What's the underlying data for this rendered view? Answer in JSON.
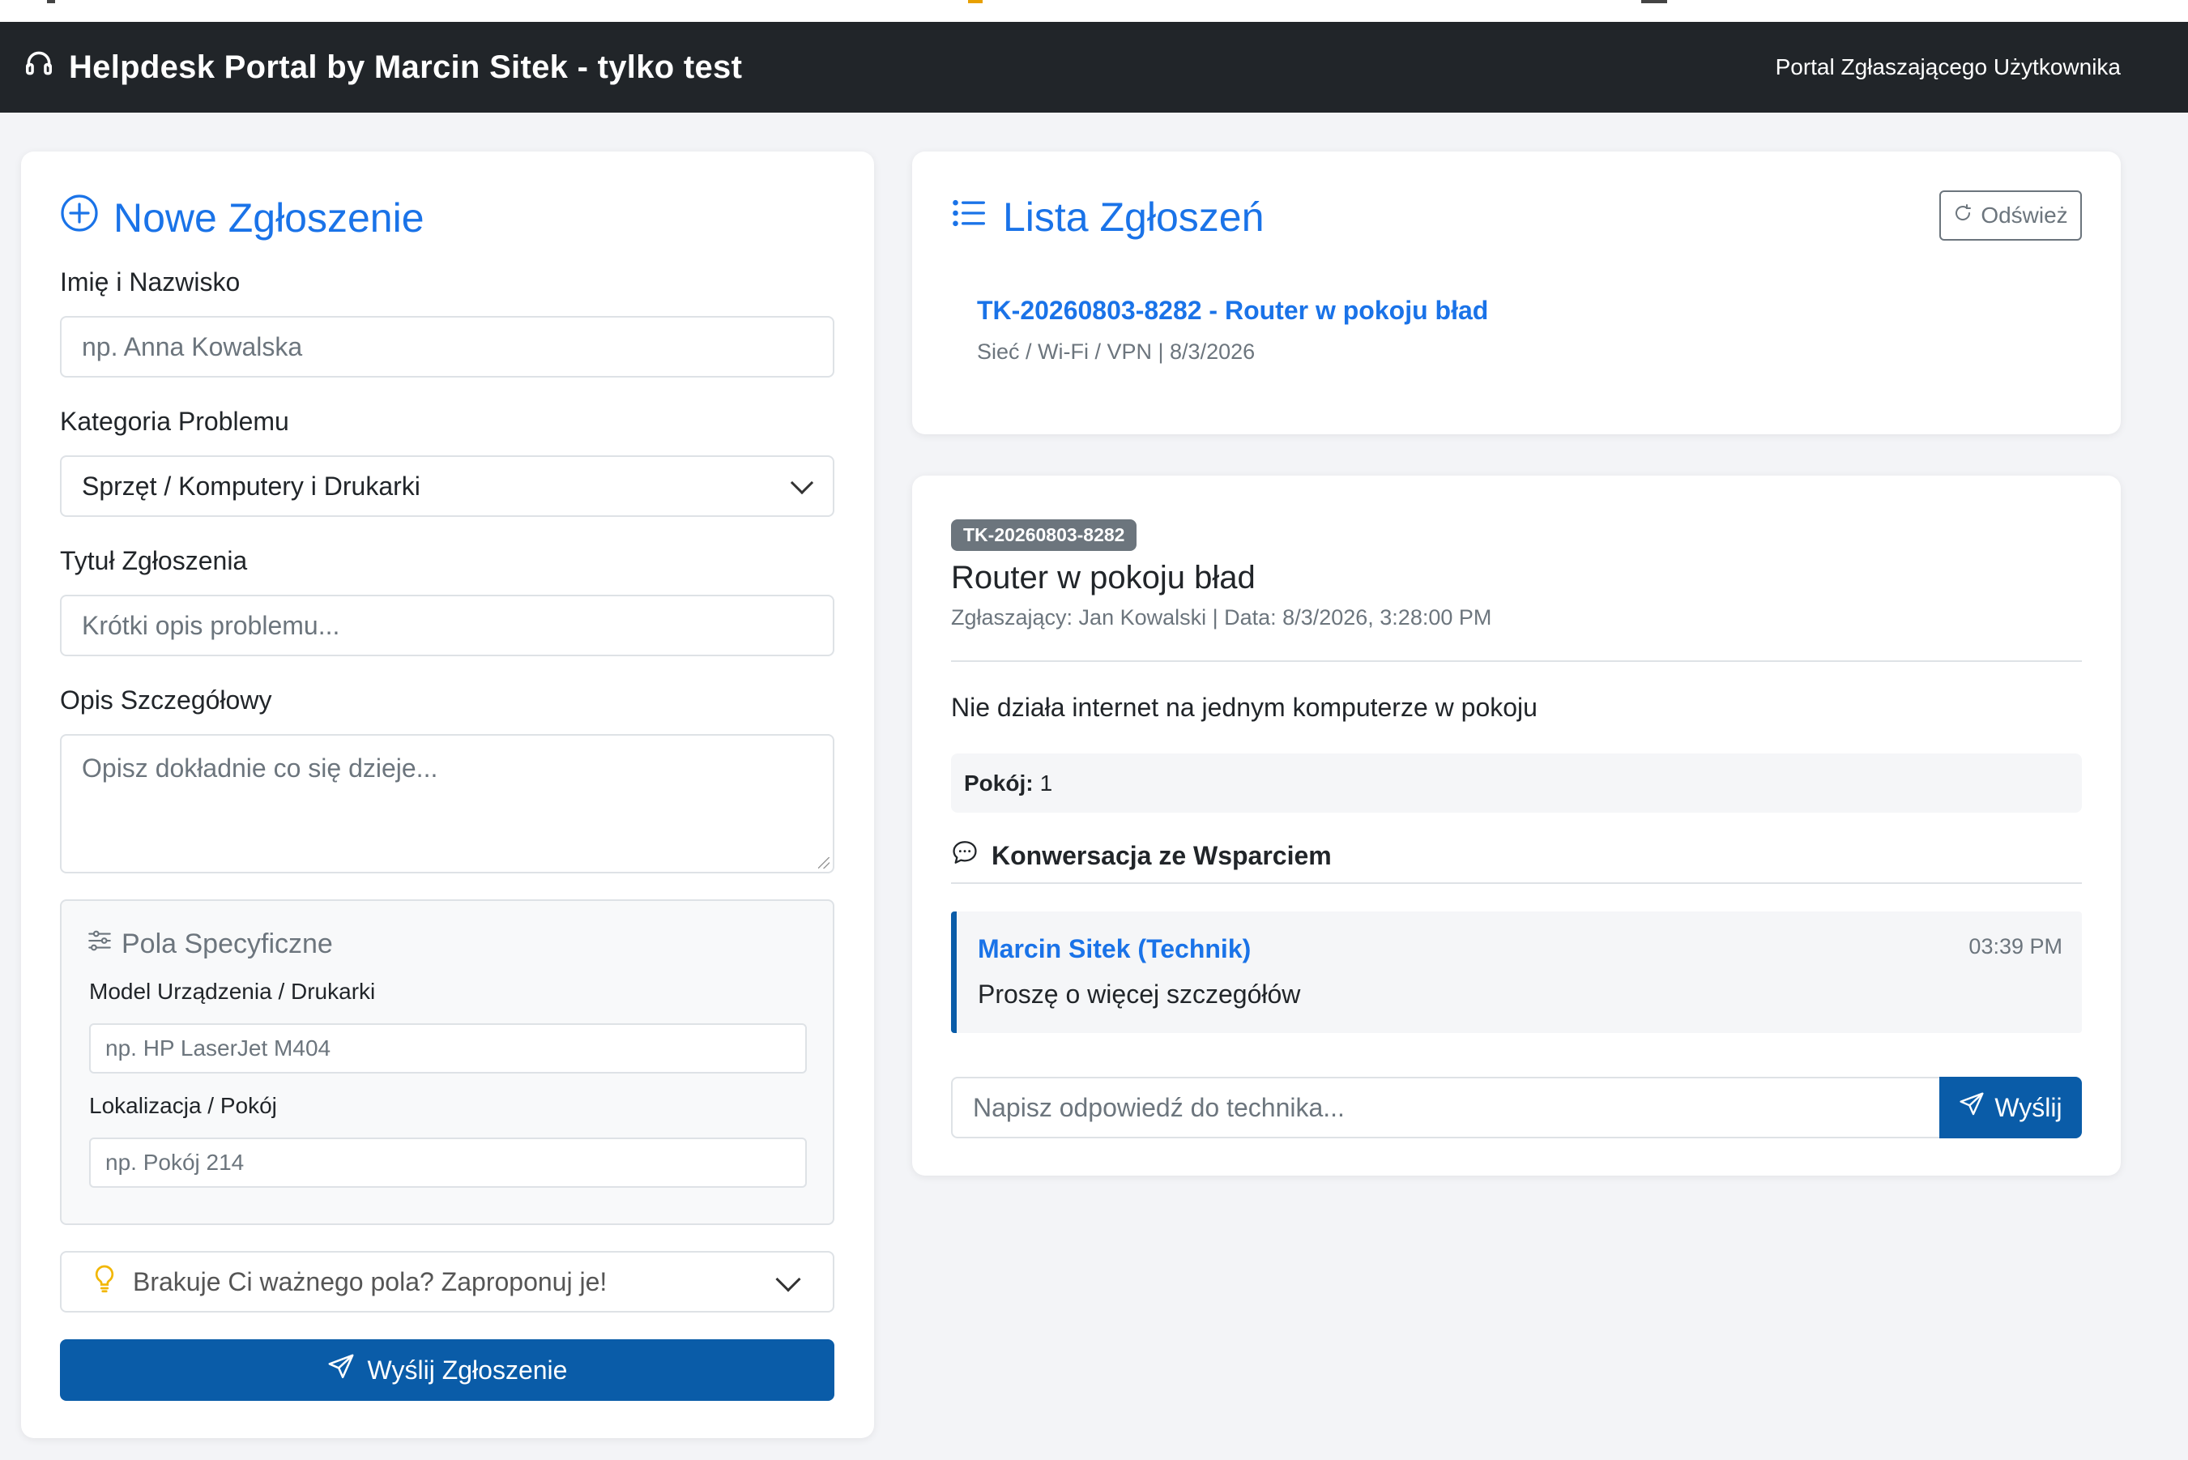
{
  "navbar": {
    "brand": "Helpdesk Portal by Marcin Sitek - tylko test",
    "portal_label": "Portal Zgłaszającego Użytkownika"
  },
  "form": {
    "title": "Nowe Zgłoszenie",
    "name_label": "Imię i Nazwisko",
    "name_placeholder": "np. Anna Kowalska",
    "category_label": "Kategoria Problemu",
    "category_value": "Sprzęt / Komputery i Drukarki",
    "subject_label": "Tytuł Zgłoszenia",
    "subject_placeholder": "Krótki opis problemu...",
    "description_label": "Opis Szczegółowy",
    "description_placeholder": "Opisz dokładnie co się dzieje...",
    "specific": {
      "title": "Pola Specyficzne",
      "model_label": "Model Urządzenia / Drukarki",
      "model_placeholder": "np. HP LaserJet M404",
      "location_label": "Lokalizacja / Pokój",
      "location_placeholder": "np. Pokój 214"
    },
    "suggest_label": "Brakuje Ci ważnego pola? Zaproponuj je!",
    "submit_label": "Wyślij Zgłoszenie"
  },
  "list": {
    "title": "Lista Zgłoszeń",
    "refresh_label": "Odśwież",
    "tickets": [
      {
        "link": "TK-20260803-8282 - Router w pokoju bład",
        "meta": "Sieć / Wi-Fi / VPN | 8/3/2026"
      }
    ]
  },
  "detail": {
    "badge": "TK-20260803-8282",
    "title": "Router w pokoju bład",
    "meta": "Zgłaszający: Jan Kowalski | Data: 8/3/2026, 3:28:00 PM",
    "description": "Nie działa internet na jednym komputerze w pokoju",
    "room_label": "Pokój:",
    "room_value": "1",
    "conversation_title": "Konwersacja ze Wsparciem",
    "messages": [
      {
        "author": "Marcin Sitek (Technik)",
        "time": "03:39 PM",
        "text": "Proszę o więcej szczegółów"
      }
    ],
    "reply_placeholder": "Napisz odpowiedź do technika...",
    "reply_button": "Wyślij"
  },
  "colors": {
    "navbar_bg": "#212529",
    "accent": "#1a73e8",
    "primary_button": "#0a5ca8",
    "badge": "#6c757d",
    "bulb": "#f2b705"
  }
}
